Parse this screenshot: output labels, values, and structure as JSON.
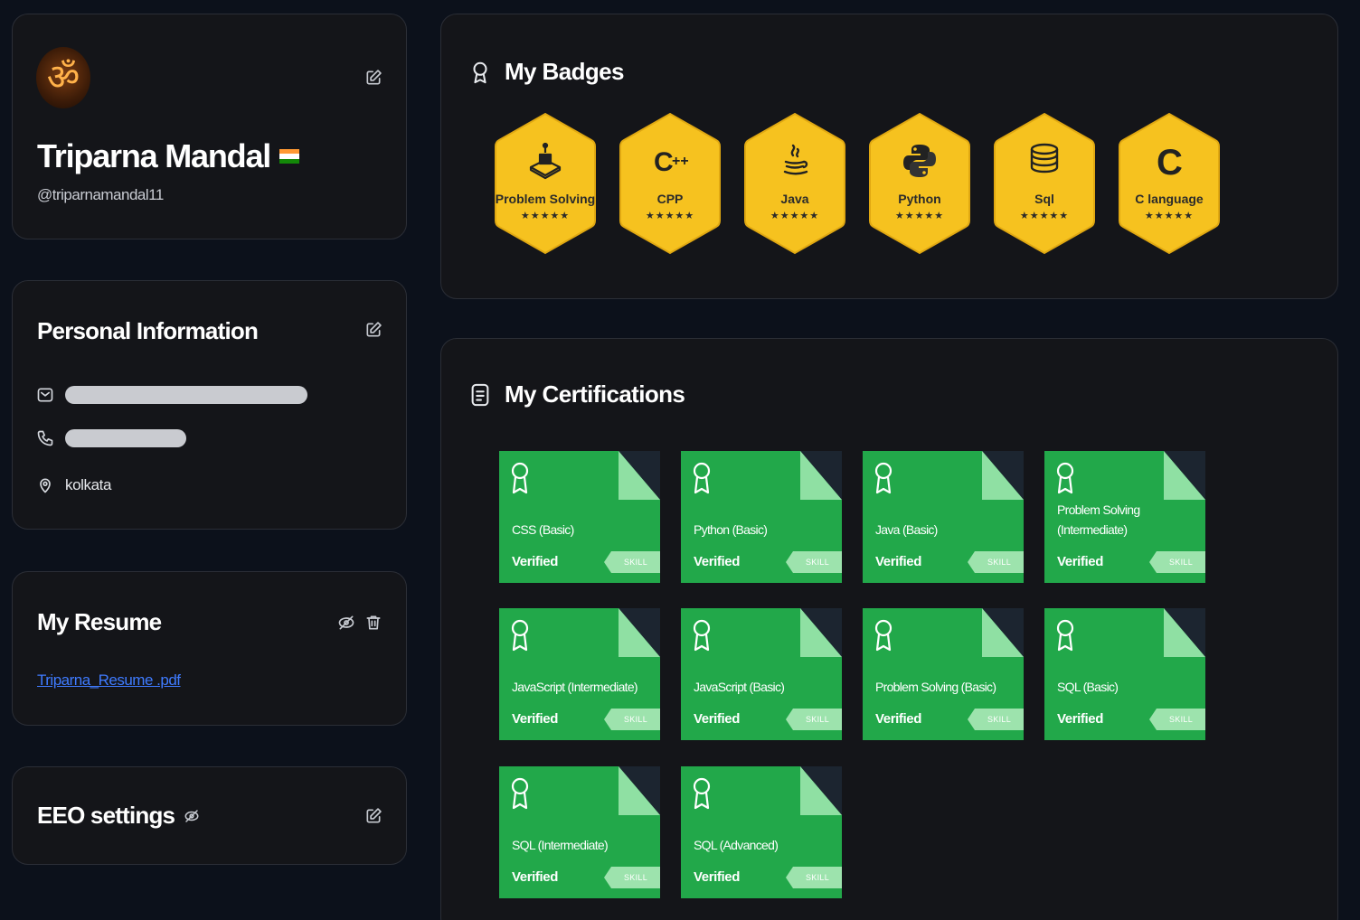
{
  "profile": {
    "avatar_glyph": "ॐ",
    "name": "Triparna Mandal",
    "handle": "@triparnamandal11",
    "flag_colors": [
      "#ff9933",
      "#ffffff",
      "#138808"
    ]
  },
  "personal": {
    "title": "Personal Information",
    "location": "kolkata"
  },
  "resume": {
    "title": "My Resume",
    "file": "Triparna_Resume .pdf"
  },
  "eeo": {
    "title": "EEO settings"
  },
  "badges": {
    "title": "My Badges",
    "items": [
      {
        "label": "Problem Solving",
        "stars": "★★★★★",
        "icon": "problem-solving-icon"
      },
      {
        "label": "CPP",
        "stars": "★★★★★",
        "icon": "cpp-icon"
      },
      {
        "label": "Java",
        "stars": "★★★★★",
        "icon": "java-icon"
      },
      {
        "label": "Python",
        "stars": "★★★★★",
        "icon": "python-icon"
      },
      {
        "label": "Sql",
        "stars": "★★★★★",
        "icon": "database-icon"
      },
      {
        "label": "C language",
        "stars": "★★★★★",
        "icon": "c-language-icon"
      }
    ]
  },
  "certs": {
    "title": "My Certifications",
    "items": [
      {
        "name": "CSS (Basic)",
        "status": "Verified",
        "tag": "SKILL"
      },
      {
        "name": "Python (Basic)",
        "status": "Verified",
        "tag": "SKILL"
      },
      {
        "name": "Java (Basic)",
        "status": "Verified",
        "tag": "SKILL"
      },
      {
        "name": "Problem Solving (Intermediate)",
        "status": "Verified",
        "tag": "SKILL"
      },
      {
        "name": "JavaScript (Intermediate)",
        "status": "Verified",
        "tag": "SKILL"
      },
      {
        "name": "JavaScript (Basic)",
        "status": "Verified",
        "tag": "SKILL"
      },
      {
        "name": "Problem Solving (Basic)",
        "status": "Verified",
        "tag": "SKILL"
      },
      {
        "name": "SQL (Basic)",
        "status": "Verified",
        "tag": "SKILL"
      },
      {
        "name": "SQL (Intermediate)",
        "status": "Verified",
        "tag": "SKILL"
      },
      {
        "name": "SQL (Advanced)",
        "status": "Verified",
        "tag": "SKILL"
      }
    ]
  },
  "colors": {
    "badge_gold": "#f6c21f",
    "cert_green": "#22a84a",
    "link_blue": "#3f7bff"
  }
}
